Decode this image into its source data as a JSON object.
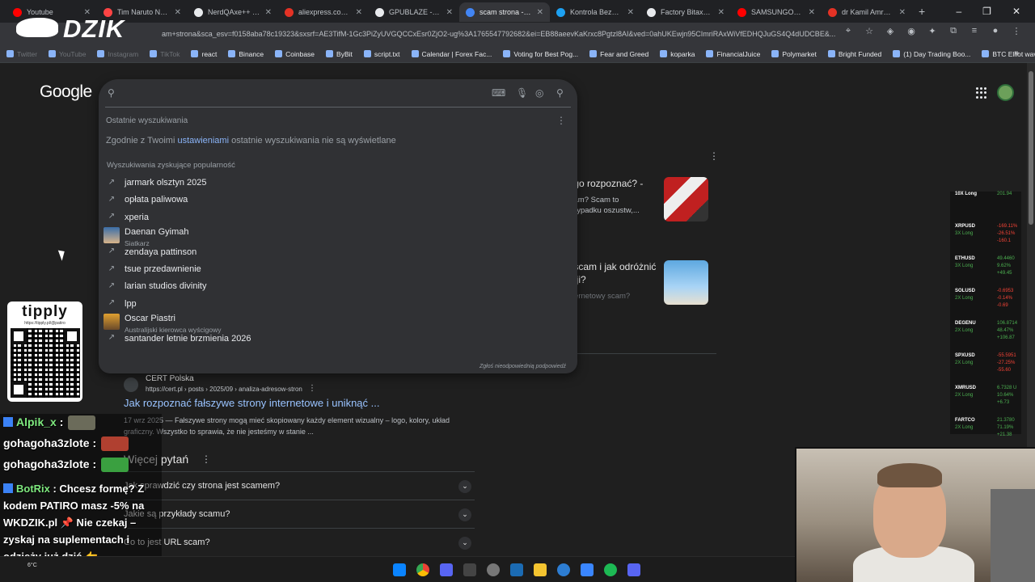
{
  "tabs": [
    {
      "title": "Youtube",
      "color": "#ff0000"
    },
    {
      "title": "Tim Naruto Nerd",
      "color": "#ff4444"
    },
    {
      "title": "NerdQAxe++ - S...",
      "color": "#e8eaed"
    },
    {
      "title": "aliexpress.com/p/...",
      "color": "#e43225"
    },
    {
      "title": "GPUBLAZE -- -75%",
      "color": "#e8eaed"
    },
    {
      "title": "scam strona - Szu...",
      "color": "#4285f4",
      "active": true
    },
    {
      "title": "Kontrola Bezpiecz...",
      "color": "#1da1f2"
    },
    {
      "title": "Factory Bitaxe Ne...",
      "color": "#e8eaed"
    },
    {
      "title": "SAMSUNGOWA C...",
      "color": "#ff0000"
    },
    {
      "title": "dr Kamil Amrah o...",
      "color": "#e43225"
    }
  ],
  "address_url": "am+strona&sca_esv=f0158aba78c19323&sxsrf=AE3TifM-1Gc3PiZyUVGQCCxEsr0ZjO2-ug%3A1765547792682&ei=EB88aeevKaKrxc8Pgtzl8AI&ved=0ahUKEwjn95CImriRAxWiVfEDHQJuGS4Q4dUDCBE&...",
  "bookmarks": [
    {
      "label": "Twitter",
      "faded": true
    },
    {
      "label": "YouTube",
      "faded": true
    },
    {
      "label": "Instagram",
      "faded": true
    },
    {
      "label": "TikTok",
      "faded": true
    },
    {
      "label": "react"
    },
    {
      "label": "Binance"
    },
    {
      "label": "Coinbase"
    },
    {
      "label": "ByBit"
    },
    {
      "label": "script.txt"
    },
    {
      "label": "Calendar | Forex Fac..."
    },
    {
      "label": "Voting for Best Pog..."
    },
    {
      "label": "Fear and Greed"
    },
    {
      "label": "koparka"
    },
    {
      "label": "FinancialJuice"
    },
    {
      "label": "Polymarket"
    },
    {
      "label": "Bright Funded"
    },
    {
      "label": "(1) Day Trading Boo..."
    },
    {
      "label": "BTC Elliot wave"
    }
  ],
  "google_logo": "Google",
  "search": {
    "recent_heading": "Ostatnie wyszukiwania",
    "recent_note_pre": "Zgodnie z Twoimi",
    "recent_note_link": "ustawieniami",
    "recent_note_post": "ostatnie wyszukiwania nie są wyświetlane",
    "popular_heading": "Wyszukiwania zyskujące popularność",
    "suggestions": [
      {
        "label": "jarmark olsztyn 2025",
        "type": "trend"
      },
      {
        "label": "opłata paliwowa",
        "type": "trend"
      },
      {
        "label": "xperia",
        "type": "trend"
      },
      {
        "label": "Daenan Gyimah",
        "sub": "Siatkarz",
        "type": "image"
      },
      {
        "label": "zendaya pattinson",
        "type": "trend"
      },
      {
        "label": "tsue przedawnienie",
        "type": "trend"
      },
      {
        "label": "larian studios divinity",
        "type": "trend"
      },
      {
        "label": "lpp",
        "type": "trend"
      },
      {
        "label": "Oscar Piastri",
        "sub": "Australijski kierowca wyścigowy",
        "type": "image"
      },
      {
        "label": "santander letnie brzmienia 2026",
        "type": "trend"
      }
    ],
    "report_label": "Zgłoś nieodpowiednią podpowiedź"
  },
  "cards": [
    {
      "title": "k go rozpoznać? -",
      "desc": "scam? Scam to\nprzypadku oszustw,..."
    },
    {
      "title": "y scam i jak odróżnić\nnzji?",
      "desc": "internetowy scam?"
    }
  ],
  "result": {
    "site": "CERT Polska",
    "breadcrumb": "https://cert.pl › posts › 2025/09 › analiza-adresow-stron",
    "title": "Jak rozpoznać fałszywe strony internetowe i uniknąć ...",
    "date": "17 wrz 2025",
    "snippet": "— Fałszywe strony mogą mieć skopiowany każdy element wizualny – logo, kolory, układ graficzny. Wszystko to sprawia, że nie jesteśmy w stanie ..."
  },
  "paa": {
    "heading": "Więcej pytań",
    "questions": [
      "Jak sprawdzić czy strona jest scamem?",
      "Jakie są przykłady scamu?",
      "Co to jest URL scam?"
    ]
  },
  "overlay": {
    "brand": "DZIK",
    "tipply_title": "tipply",
    "tipply_url": "https://tipply.pl/@patiro"
  },
  "chat": [
    {
      "user": "Alpik_x",
      "text": ":"
    },
    {
      "user": "gohagoha3zlote",
      "text": ":"
    },
    {
      "user": "gohagoha3zlote",
      "text": ":"
    }
  ],
  "bot_message": {
    "user": "BotRix",
    "text": ": Chcesz formę? Z kodem PATIRO masz -5% na WKDZIK.pl 📌 Nie czekaj – zyskaj na suplementach i odzieży już dziś 👉 https://wkdzik.pl/"
  },
  "ticker": [
    {
      "sym": "10X Long",
      "lev": "",
      "vals": [
        "201.94"
      ]
    },
    {
      "sym": "XRPUSD",
      "lev": "3X Long",
      "vals": [
        "-169.11%",
        "-26.51%",
        "-160.1"
      ]
    },
    {
      "sym": "ETHUSD",
      "lev": "3X Long",
      "vals": [
        "49.4460",
        "9.62%",
        "+49.45"
      ]
    },
    {
      "sym": "SOLUSD",
      "lev": "2X Long",
      "vals": [
        "-0.6953",
        "-0.14%",
        "-0.69"
      ]
    },
    {
      "sym": "DEGENU",
      "lev": "2X Long",
      "vals": [
        "106.8714",
        "48.47%",
        "+106.87"
      ]
    },
    {
      "sym": "SPXUSD",
      "lev": "2X Long",
      "vals": [
        "-55.5951",
        "-27.25%",
        "-55.60"
      ]
    },
    {
      "sym": "XMRUSD",
      "lev": "2X Long",
      "vals": [
        "6.7328 U",
        "10.64%",
        "+6.73"
      ]
    },
    {
      "sym": "FARTCO",
      "lev": "2X Long",
      "vals": [
        "21.3780",
        "71.19%",
        "+21.38"
      ]
    }
  ],
  "weather": "6°C"
}
